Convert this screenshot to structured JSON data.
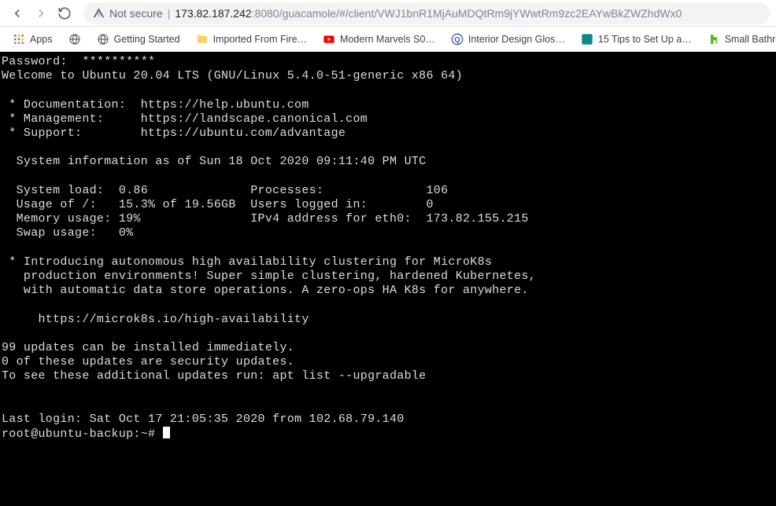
{
  "address": {
    "not_secure": "Not secure",
    "host_pre": "173.82.187.242",
    "port_path": ":8080/guacamole/#/client/VWJ1bnR1MjAuMDQtRm9jYWwtRm9zc2EAYwBkZWZhdWx0"
  },
  "bookmarks": [
    {
      "label": "Apps",
      "icon": "apps"
    },
    {
      "label": "",
      "icon": "globe"
    },
    {
      "label": "Getting Started",
      "icon": "globe"
    },
    {
      "label": "Imported From Fire…",
      "icon": "folder"
    },
    {
      "label": "Modern Marvels S0…",
      "icon": "youtube"
    },
    {
      "label": "Interior Design Glos…",
      "icon": "q"
    },
    {
      "label": "15 Tips to Set Up a…",
      "icon": "teal"
    },
    {
      "label": "Small Bathroom Col…",
      "icon": "houzz"
    }
  ],
  "terminal": {
    "line_password": "Password:  **********",
    "line_welcome": "Welcome to Ubuntu 20.04 LTS (GNU/Linux 5.4.0-51-generic x86 64)",
    "line_doc": " * Documentation:  https://help.ubuntu.com",
    "line_mgmt": " * Management:     https://landscape.canonical.com",
    "line_support": " * Support:        https://ubuntu.com/advantage",
    "line_sysinfo_hdr": "  System information as of Sun 18 Oct 2020 09:11:40 PM UTC",
    "line_load": "  System load:  0.86              Processes:              106",
    "line_usage": "  Usage of /:   15.3% of 19.56GB  Users logged in:        0",
    "line_mem": "  Memory usage: 19%               IPv4 address for eth0:  173.82.155.215",
    "line_swap": "  Swap usage:   0%",
    "line_microk8s_1": " * Introducing autonomous high availability clustering for MicroK8s",
    "line_microk8s_2": "   production environments! Super simple clustering, hardened Kubernetes,",
    "line_microk8s_3": "   with automatic data store operations. A zero-ops HA K8s for anywhere.",
    "line_microk8s_url": "     https://microk8s.io/high-availability",
    "line_updates_1": "99 updates can be installed immediately.",
    "line_updates_2": "0 of these updates are security updates.",
    "line_updates_3": "To see these additional updates run: apt list --upgradable",
    "line_lastlogin": "Last login: Sat Oct 17 21:05:35 2020 from 102.68.79.140",
    "prompt": "root@ubuntu-backup:~# "
  }
}
